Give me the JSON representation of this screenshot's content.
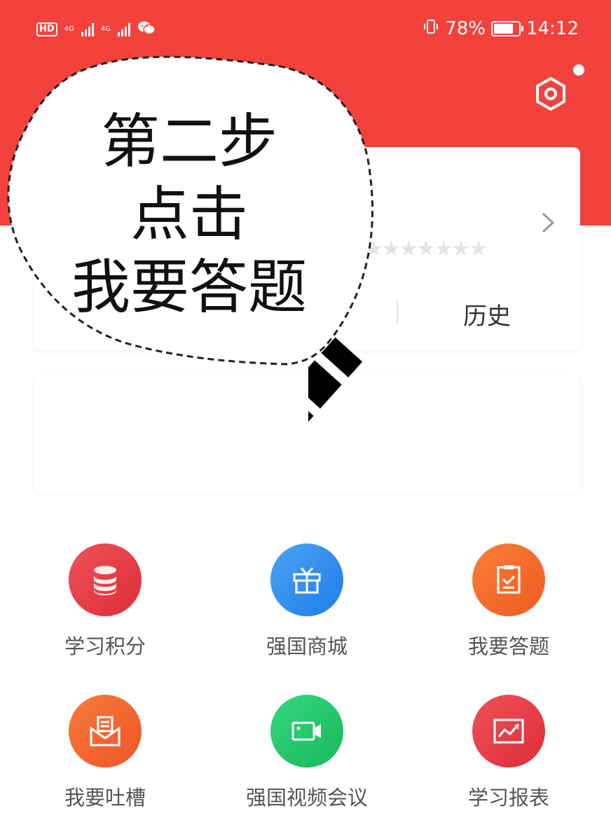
{
  "status_bar": {
    "hd": "HD",
    "network_1": "4G",
    "network_2": "4G",
    "battery_percent": "78%",
    "battery_level": 0.78,
    "time": "14:12"
  },
  "profile_card": {
    "stars": "★★★★★★★",
    "history_label": "历史"
  },
  "annotation": {
    "line1": "第二步",
    "line2": "点击",
    "line3": "我要答题"
  },
  "grid": {
    "items": [
      {
        "label": "学习积分",
        "icon": "database-icon",
        "color": "#e73a44"
      },
      {
        "label": "强国商城",
        "icon": "gift-icon",
        "color": "#2f8ef0"
      },
      {
        "label": "我要答题",
        "icon": "clipboard-check-icon",
        "color": "#f66a2c"
      },
      {
        "label": "我要吐槽",
        "icon": "mail-icon",
        "color": "#f5642c"
      },
      {
        "label": "强国视频会议",
        "icon": "video-camera-icon",
        "color": "#22c46a"
      },
      {
        "label": "学习报表",
        "icon": "chart-icon",
        "color": "#e73a44"
      }
    ]
  },
  "colors": {
    "header": "#f2423b"
  }
}
